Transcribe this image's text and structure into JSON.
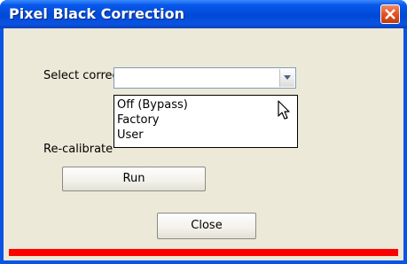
{
  "window": {
    "title": "Pixel Black Correction"
  },
  "main": {
    "select_label": "Select correction settings",
    "combo_value": "",
    "options": [
      "Off (Bypass)",
      "Factory",
      "User"
    ],
    "recalibrate_label": "Re-calibrate",
    "run_label": "Run",
    "close_label": "Close"
  },
  "colors": {
    "title_bar": "#0a54e4",
    "dialog_bg": "#ece9d8",
    "status_bar": "#ff0000"
  },
  "icons": {
    "close": "close-icon",
    "dropdown_arrow": "chevron-down-icon",
    "cursor": "mouse-pointer-icon"
  }
}
